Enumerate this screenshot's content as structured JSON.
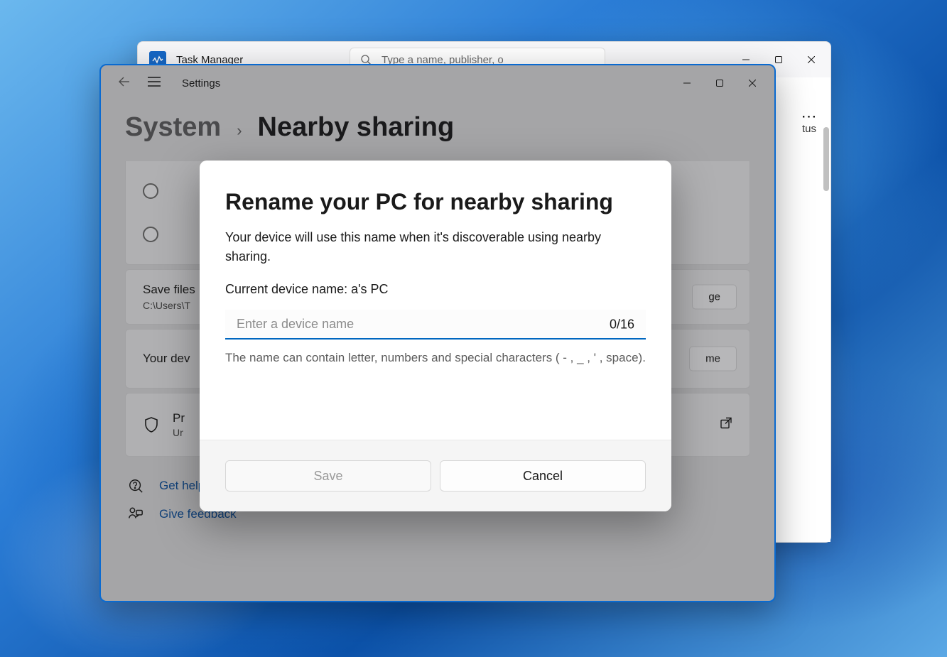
{
  "task_manager": {
    "title": "Task Manager",
    "search_placeholder": "Type a name, publisher, o",
    "column_status": "tus",
    "more_menu": "⋯"
  },
  "settings": {
    "app_title": "Settings",
    "breadcrumb": {
      "parent": "System",
      "chevron": "›",
      "page": "Nearby sharing"
    },
    "cards": {
      "save_files": {
        "title": "Save files",
        "subtitle": "C:\\Users\\T",
        "button": "ge"
      },
      "device_name": {
        "title": "Your dev",
        "button": "me"
      },
      "privacy": {
        "title": "Pr",
        "subtitle": "Ur"
      }
    },
    "links": {
      "get_help": "Get help",
      "give_feedback": "Give feedback"
    }
  },
  "dialog": {
    "title": "Rename your PC for nearby sharing",
    "description": "Your device will use this name when it's discoverable using nearby sharing.",
    "current_label": "Current device name: a's PC",
    "input_placeholder": "Enter a device name",
    "counter": "0/16",
    "hint": "The name can contain letter, numbers and special characters ( - , _ , ' , space).",
    "save_label": "Save",
    "cancel_label": "Cancel"
  }
}
